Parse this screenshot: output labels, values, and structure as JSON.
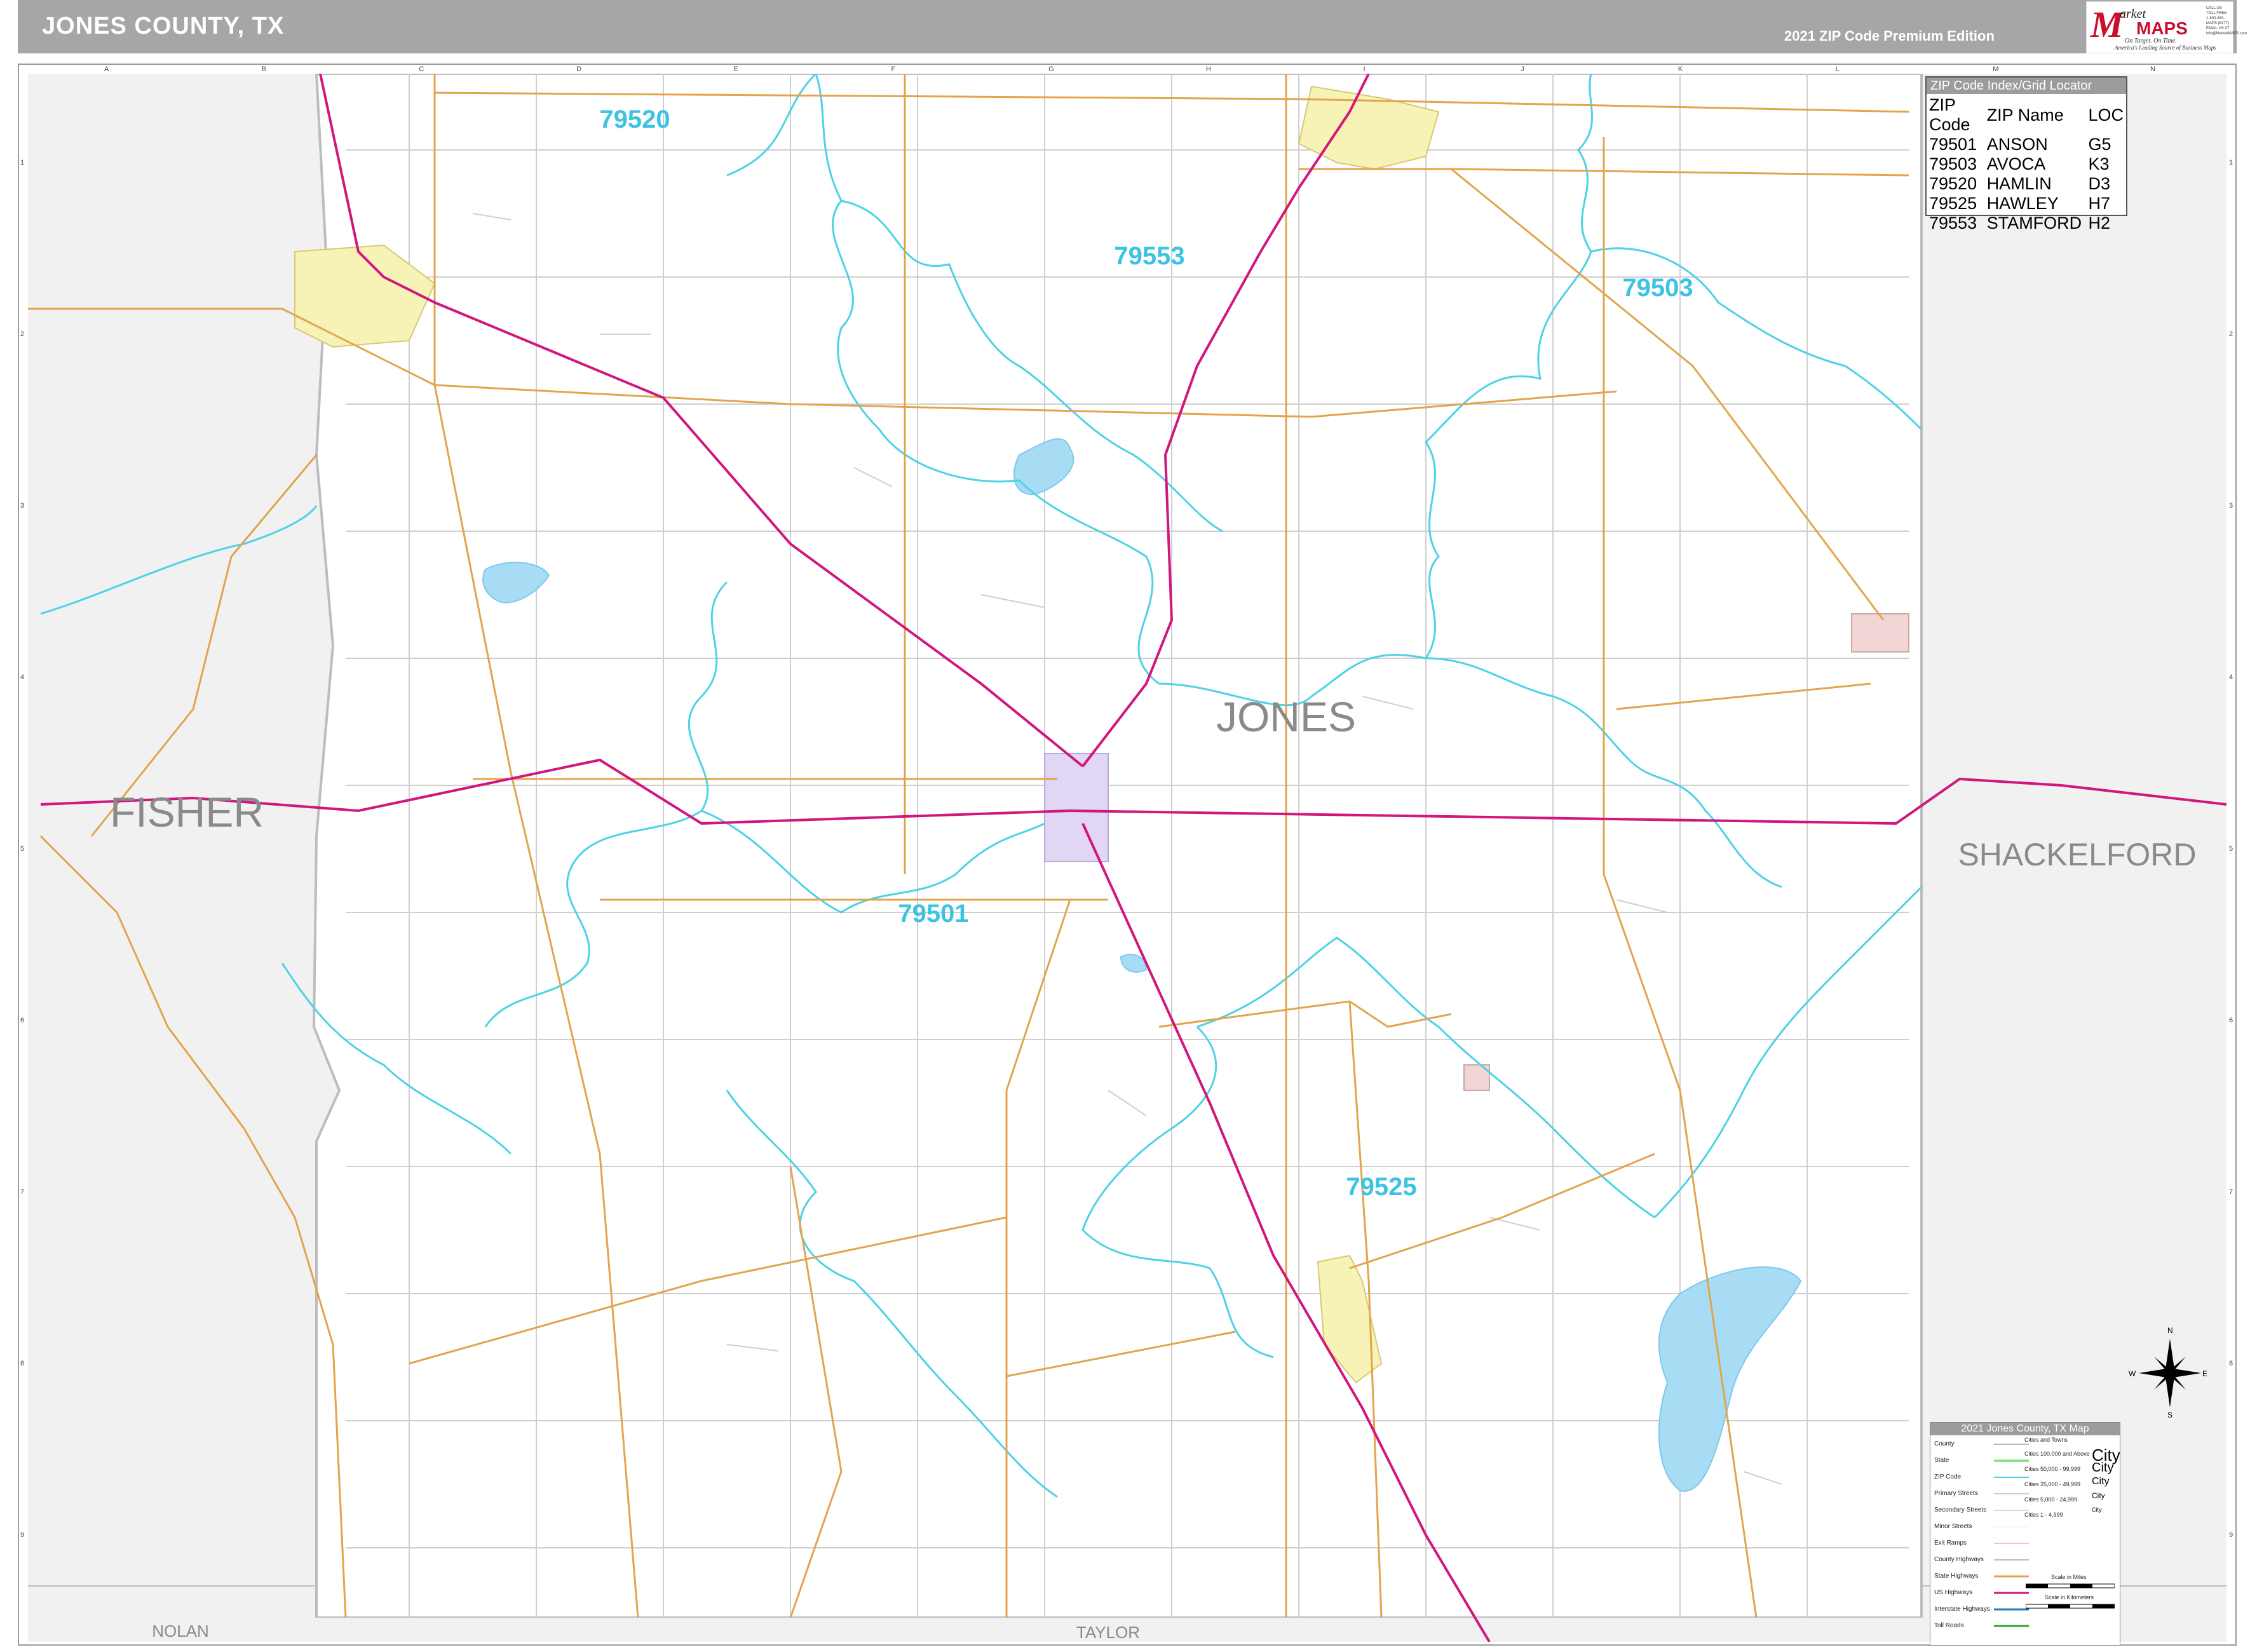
{
  "header": {
    "title": "JONES COUNTY, TX",
    "edition": "2021 ZIP Code Premium Edition"
  },
  "logo": {
    "m": "M",
    "arket": "arket",
    "maps": "MAPS",
    "tagline1": "On Target. On Time.",
    "tagline2": "America's Leading Source of Business Maps",
    "contact1": "CALL US TOLL FREE",
    "contact2": "1-800-334-MAPS (6277)",
    "contact3": "EMAIL US AT",
    "contact4": "info@MarketMAPS.com"
  },
  "grid": {
    "columns": [
      "A",
      "B",
      "C",
      "D",
      "E",
      "F",
      "G",
      "H",
      "I",
      "J",
      "K",
      "L",
      "M",
      "N"
    ],
    "rows": [
      "1",
      "2",
      "3",
      "4",
      "5",
      "6",
      "7",
      "8",
      "9"
    ]
  },
  "map": {
    "county_name": "JONES",
    "neighbors": {
      "west": "FISHER",
      "east": "SHACKELFORD",
      "south_west": "NOLAN",
      "south": "TAYLOR"
    },
    "zip_labels": [
      "79520",
      "79553",
      "79503",
      "79501",
      "79525"
    ],
    "colors": {
      "zip_boundary": "#4dd2e6",
      "zip_label": "#3cc3e3",
      "us_highway": "#d1177e",
      "state_highway": "#e2a44c",
      "secondary": "#cfcfcf",
      "county_fill": "#f1f1f1",
      "water": "#a8dcf5",
      "city_yellow": "#f7f2b6",
      "city_purple": "#e1d6f3",
      "city_pink": "#f2d6d6"
    }
  },
  "zip_index": {
    "title": "ZIP Code Index/Grid Locator",
    "headers": [
      "ZIP Code",
      "ZIP Name",
      "LOC"
    ],
    "rows": [
      [
        "79501",
        "ANSON",
        "G5"
      ],
      [
        "79503",
        "AVOCA",
        "K3"
      ],
      [
        "79520",
        "HAMLIN",
        "D3"
      ],
      [
        "79525",
        "HAWLEY",
        "H7"
      ],
      [
        "79553",
        "STAMFORD",
        "H2"
      ]
    ]
  },
  "legend": {
    "title": "2021 Jones County, TX Map",
    "items": [
      "County",
      "State",
      "ZIP Code",
      "Primary Streets",
      "Secondary Streets",
      "Minor Streets",
      "Exit Ramps",
      "County Highways",
      "State Highways",
      "US Highways",
      "Interstate Highways",
      "Toll Roads"
    ],
    "cities_header": "Cities and Towns",
    "city_classes": [
      "Cities 100,000 and Above",
      "Cities 50,000 - 99,999",
      "Cities 25,000 - 49,999",
      "Cities 5,000 - 24,999",
      "Cities 1 - 4,999"
    ],
    "city_samples": [
      "City",
      "City",
      "City",
      "City",
      "City"
    ],
    "scale_miles": "Scale in Miles",
    "scale_km": "Scale in Kilometers"
  },
  "compass": {
    "n": "N",
    "s": "S",
    "e": "E",
    "w": "W"
  }
}
